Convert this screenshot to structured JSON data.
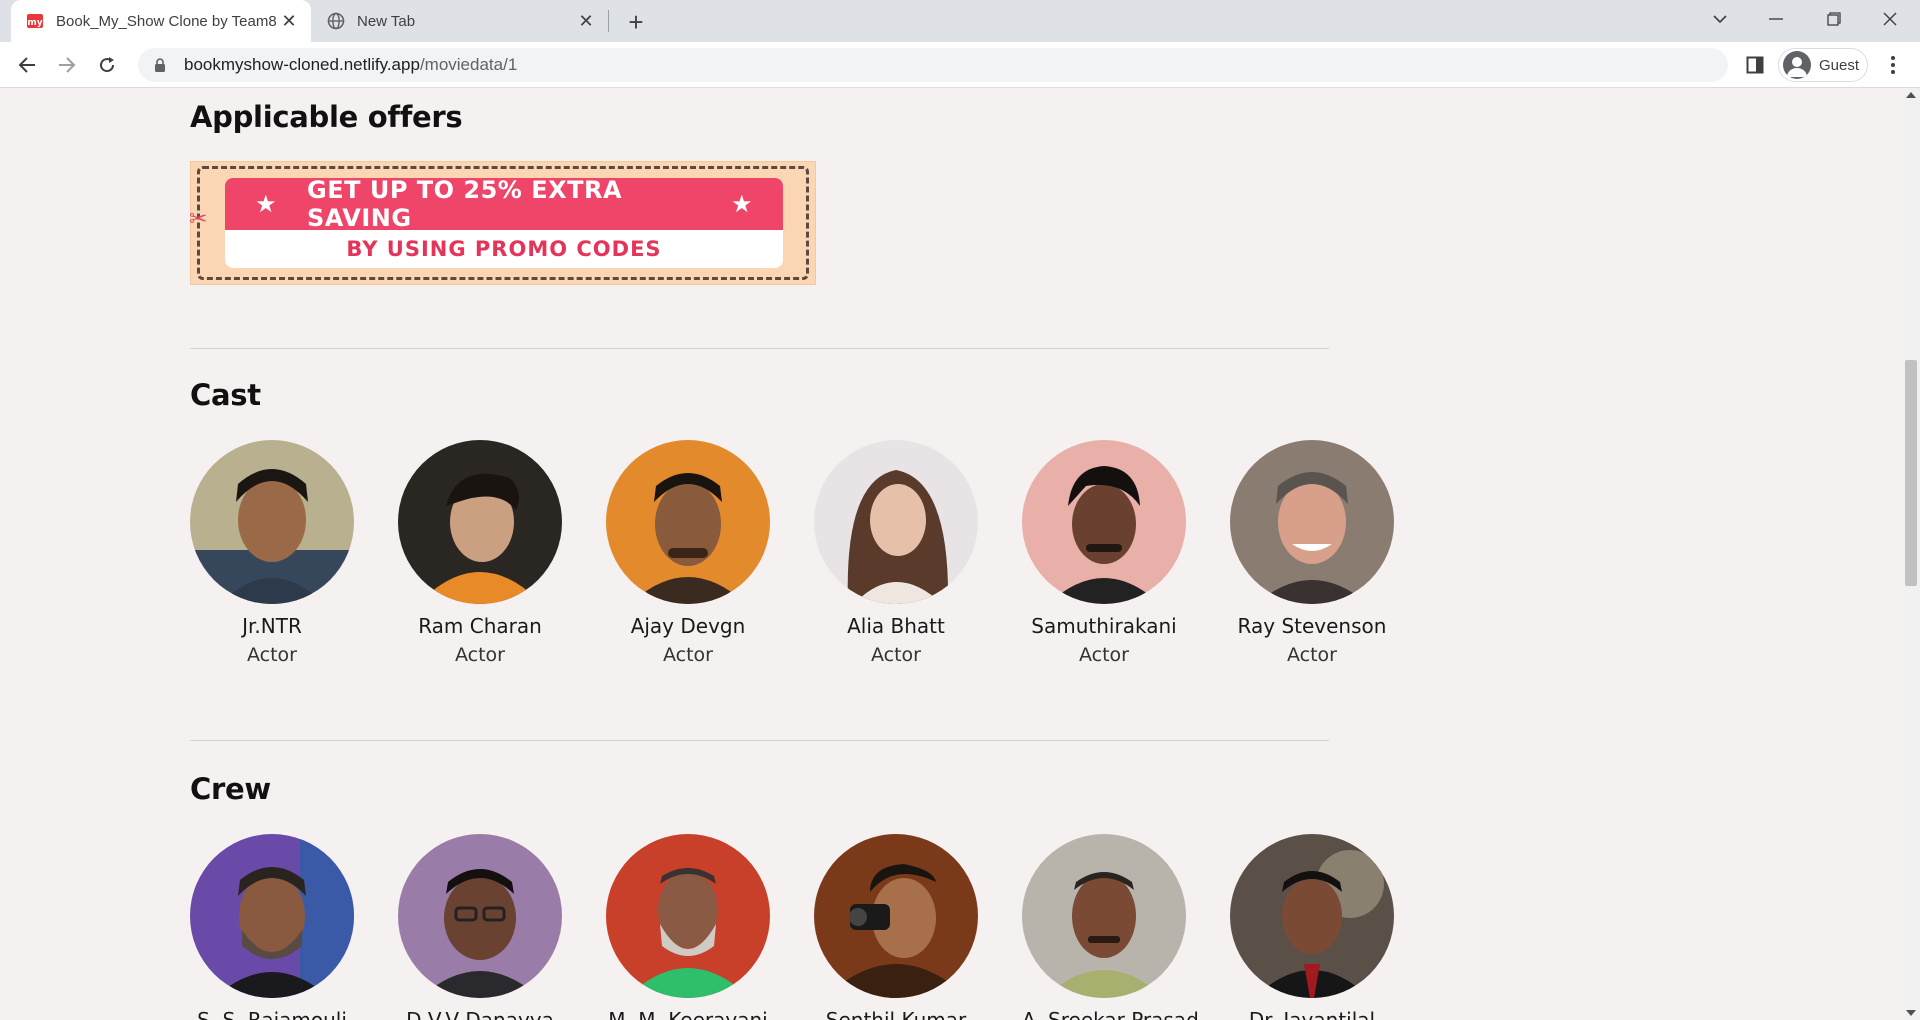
{
  "browser": {
    "tabs": [
      {
        "title": "Book_My_Show Clone by Team8",
        "active": true,
        "icon": "bookmyshow-favicon"
      },
      {
        "title": "New Tab",
        "active": false,
        "icon": "globe-icon"
      }
    ],
    "address": {
      "host": "bookmyshow-cloned.netlify.app",
      "path": "/moviedata/1"
    },
    "profile_label": "Guest"
  },
  "offers": {
    "heading": "Applicable offers",
    "banner_line1": "GET UP TO 25% EXTRA SAVING",
    "banner_line2": "BY USING PROMO CODES",
    "colors": {
      "pink": "#ee4569",
      "peach": "#fbd6b3"
    }
  },
  "cast": {
    "heading": "Cast",
    "members": [
      {
        "name": "Jr.NTR",
        "role": "Actor"
      },
      {
        "name": "Ram Charan",
        "role": "Actor"
      },
      {
        "name": "Ajay Devgn",
        "role": "Actor"
      },
      {
        "name": "Alia Bhatt",
        "role": "Actor"
      },
      {
        "name": "Samuthirakani",
        "role": "Actor"
      },
      {
        "name": "Ray Stevenson",
        "role": "Actor"
      }
    ]
  },
  "crew": {
    "heading": "Crew",
    "members": [
      {
        "name": "S. S. Rajamouli"
      },
      {
        "name": "D.V.V Danayya"
      },
      {
        "name": "M. M. Keeravani"
      },
      {
        "name": "Senthil Kumar"
      },
      {
        "name": "A. Sreekar Prasad"
      },
      {
        "name": "Dr. Jayantilal"
      }
    ]
  }
}
